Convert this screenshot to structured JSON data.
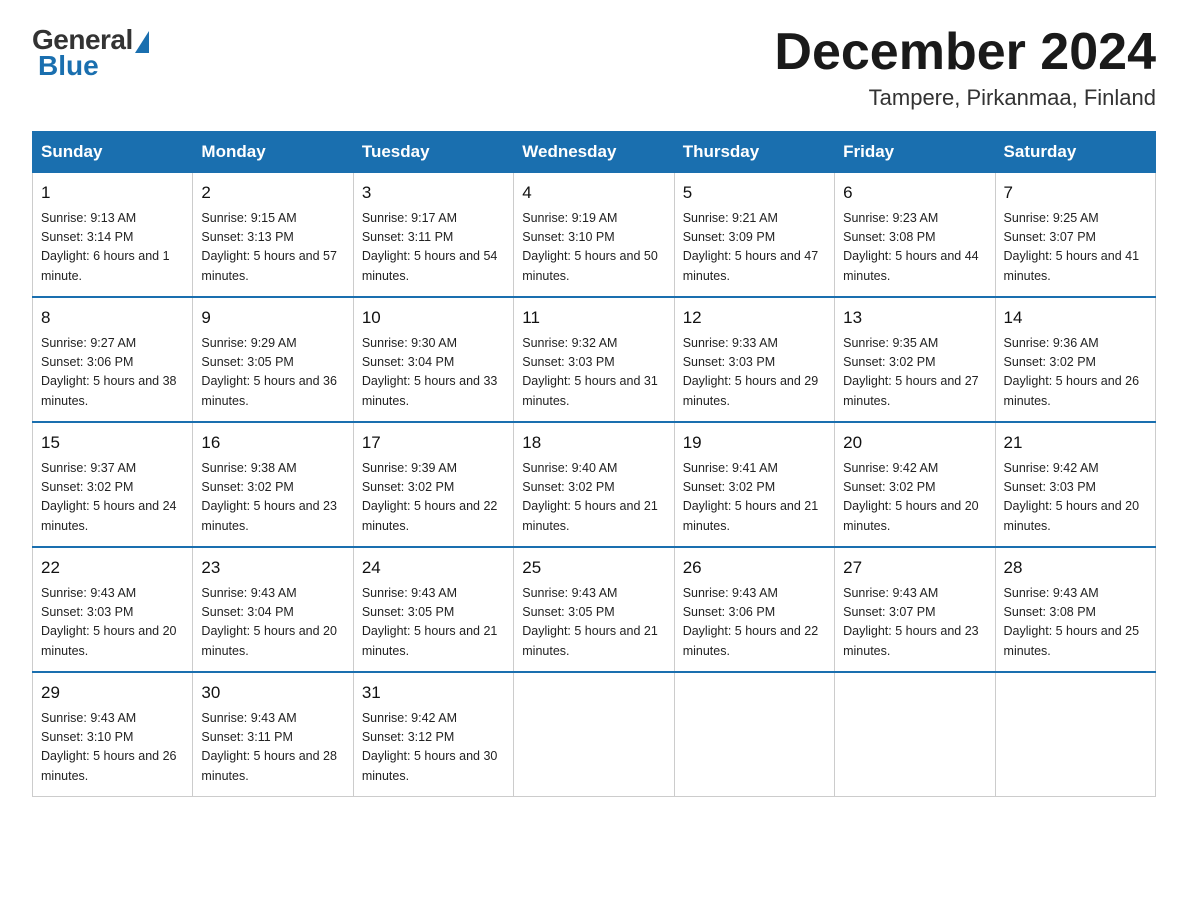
{
  "logo": {
    "general": "General",
    "blue": "Blue"
  },
  "title": "December 2024",
  "location": "Tampere, Pirkanmaa, Finland",
  "days_header": [
    "Sunday",
    "Monday",
    "Tuesday",
    "Wednesday",
    "Thursday",
    "Friday",
    "Saturday"
  ],
  "weeks": [
    [
      {
        "day": "1",
        "sunrise": "9:13 AM",
        "sunset": "3:14 PM",
        "daylight": "6 hours and 1 minute."
      },
      {
        "day": "2",
        "sunrise": "9:15 AM",
        "sunset": "3:13 PM",
        "daylight": "5 hours and 57 minutes."
      },
      {
        "day": "3",
        "sunrise": "9:17 AM",
        "sunset": "3:11 PM",
        "daylight": "5 hours and 54 minutes."
      },
      {
        "day": "4",
        "sunrise": "9:19 AM",
        "sunset": "3:10 PM",
        "daylight": "5 hours and 50 minutes."
      },
      {
        "day": "5",
        "sunrise": "9:21 AM",
        "sunset": "3:09 PM",
        "daylight": "5 hours and 47 minutes."
      },
      {
        "day": "6",
        "sunrise": "9:23 AM",
        "sunset": "3:08 PM",
        "daylight": "5 hours and 44 minutes."
      },
      {
        "day": "7",
        "sunrise": "9:25 AM",
        "sunset": "3:07 PM",
        "daylight": "5 hours and 41 minutes."
      }
    ],
    [
      {
        "day": "8",
        "sunrise": "9:27 AM",
        "sunset": "3:06 PM",
        "daylight": "5 hours and 38 minutes."
      },
      {
        "day": "9",
        "sunrise": "9:29 AM",
        "sunset": "3:05 PM",
        "daylight": "5 hours and 36 minutes."
      },
      {
        "day": "10",
        "sunrise": "9:30 AM",
        "sunset": "3:04 PM",
        "daylight": "5 hours and 33 minutes."
      },
      {
        "day": "11",
        "sunrise": "9:32 AM",
        "sunset": "3:03 PM",
        "daylight": "5 hours and 31 minutes."
      },
      {
        "day": "12",
        "sunrise": "9:33 AM",
        "sunset": "3:03 PM",
        "daylight": "5 hours and 29 minutes."
      },
      {
        "day": "13",
        "sunrise": "9:35 AM",
        "sunset": "3:02 PM",
        "daylight": "5 hours and 27 minutes."
      },
      {
        "day": "14",
        "sunrise": "9:36 AM",
        "sunset": "3:02 PM",
        "daylight": "5 hours and 26 minutes."
      }
    ],
    [
      {
        "day": "15",
        "sunrise": "9:37 AM",
        "sunset": "3:02 PM",
        "daylight": "5 hours and 24 minutes."
      },
      {
        "day": "16",
        "sunrise": "9:38 AM",
        "sunset": "3:02 PM",
        "daylight": "5 hours and 23 minutes."
      },
      {
        "day": "17",
        "sunrise": "9:39 AM",
        "sunset": "3:02 PM",
        "daylight": "5 hours and 22 minutes."
      },
      {
        "day": "18",
        "sunrise": "9:40 AM",
        "sunset": "3:02 PM",
        "daylight": "5 hours and 21 minutes."
      },
      {
        "day": "19",
        "sunrise": "9:41 AM",
        "sunset": "3:02 PM",
        "daylight": "5 hours and 21 minutes."
      },
      {
        "day": "20",
        "sunrise": "9:42 AM",
        "sunset": "3:02 PM",
        "daylight": "5 hours and 20 minutes."
      },
      {
        "day": "21",
        "sunrise": "9:42 AM",
        "sunset": "3:03 PM",
        "daylight": "5 hours and 20 minutes."
      }
    ],
    [
      {
        "day": "22",
        "sunrise": "9:43 AM",
        "sunset": "3:03 PM",
        "daylight": "5 hours and 20 minutes."
      },
      {
        "day": "23",
        "sunrise": "9:43 AM",
        "sunset": "3:04 PM",
        "daylight": "5 hours and 20 minutes."
      },
      {
        "day": "24",
        "sunrise": "9:43 AM",
        "sunset": "3:05 PM",
        "daylight": "5 hours and 21 minutes."
      },
      {
        "day": "25",
        "sunrise": "9:43 AM",
        "sunset": "3:05 PM",
        "daylight": "5 hours and 21 minutes."
      },
      {
        "day": "26",
        "sunrise": "9:43 AM",
        "sunset": "3:06 PM",
        "daylight": "5 hours and 22 minutes."
      },
      {
        "day": "27",
        "sunrise": "9:43 AM",
        "sunset": "3:07 PM",
        "daylight": "5 hours and 23 minutes."
      },
      {
        "day": "28",
        "sunrise": "9:43 AM",
        "sunset": "3:08 PM",
        "daylight": "5 hours and 25 minutes."
      }
    ],
    [
      {
        "day": "29",
        "sunrise": "9:43 AM",
        "sunset": "3:10 PM",
        "daylight": "5 hours and 26 minutes."
      },
      {
        "day": "30",
        "sunrise": "9:43 AM",
        "sunset": "3:11 PM",
        "daylight": "5 hours and 28 minutes."
      },
      {
        "day": "31",
        "sunrise": "9:42 AM",
        "sunset": "3:12 PM",
        "daylight": "5 hours and 30 minutes."
      },
      null,
      null,
      null,
      null
    ]
  ]
}
